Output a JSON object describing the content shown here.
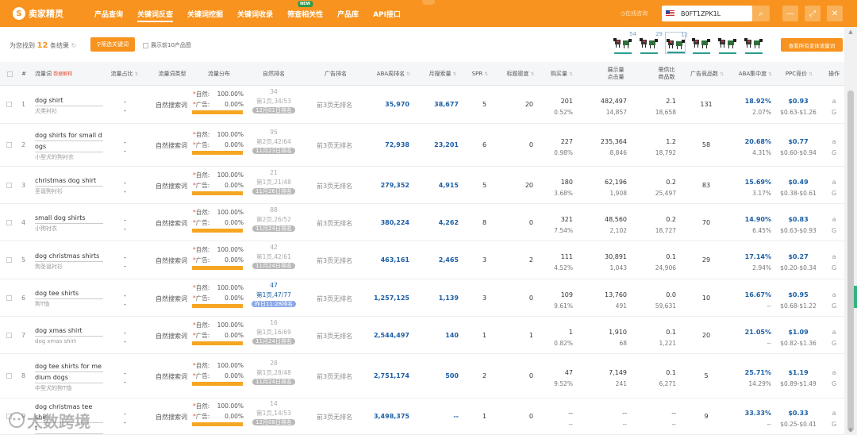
{
  "app": {
    "logo_text": "卖家精灵",
    "nav": [
      {
        "label": "产品查询"
      },
      {
        "label": "关键词反查",
        "active": true
      },
      {
        "label": "关键词挖掘"
      },
      {
        "label": "关键词收录"
      },
      {
        "label": "筛查相关性",
        "badge": "NEW"
      },
      {
        "label": "产品库"
      },
      {
        "label": "API接口"
      }
    ],
    "online_help": "在线咨询",
    "asin_value": "B0FT1ZPK1L",
    "accent_color": "#f7931e"
  },
  "toolbar": {
    "found_prefix": "为您找到",
    "found_count": "12",
    "found_suffix": "条结果",
    "filter_button": "筛选关键词",
    "top10_label": "展示前10产品图",
    "view_all_button": "查看所有变体流量词",
    "thumbs": [
      {
        "count": "54"
      },
      {
        "count": "29"
      },
      {
        "count": "12",
        "selected": true
      },
      {
        "count": ""
      },
      {
        "count": ""
      },
      {
        "count": ""
      }
    ]
  },
  "table": {
    "headers": {
      "idx": "#",
      "keyword": "流量词",
      "keyword_tag": "数据解释",
      "share": "流量占比",
      "type": "流量词类型",
      "dist": "流量分布",
      "natural": "自然排名",
      "ad": "广告排名",
      "aba": "ABA周排名",
      "monthly": "月搜索量",
      "spr": "SPR",
      "title": "标题密度",
      "purchase": "购买量",
      "impr": "展示量\n点击量",
      "supply": "需供比\n商品数",
      "ads_count": "广告竞品数",
      "aba_conc": "ABA集中度",
      "ppc": "PPC竞价",
      "ops": "操作"
    },
    "flow_natural_label": "自然:",
    "flow_ad_label": "广告:",
    "rows": [
      {
        "idx": "1",
        "kw": [
          "dog shirt"
        ],
        "cn": "犬类衬衫",
        "share": "-",
        "share2": "-",
        "type": "自然搜索词",
        "nat_pct": "100.00%",
        "ad_pct": "0.00%",
        "rank_top": "34",
        "rank_mid": "第1页,34/53",
        "rank_date": "12月01日排名",
        "ad_rank": "前3页无排名",
        "aba": "35,970",
        "monthly": "38,677",
        "spr": "5",
        "title": "20",
        "purchase": "201",
        "purchase_pct": "0.52%",
        "impr": "482,497",
        "clicks": "14,857",
        "ratio": "2.1",
        "goods": "18,658",
        "ads": "131",
        "conc": "18.92%",
        "conc2": "2.07%",
        "ppc": "$0.93",
        "ppc_range": "$0.63-$1.26"
      },
      {
        "idx": "2",
        "kw": [
          "dog shirts for small d",
          "ogs"
        ],
        "cn": "小型犬的狗衬衣",
        "share": "-",
        "share2": "-",
        "type": "自然搜索词",
        "nat_pct": "100.00%",
        "ad_pct": "0.00%",
        "rank_top": "95",
        "rank_mid": "第2页,42/64",
        "rank_date": "11月23日排名",
        "ad_rank": "前3页无排名",
        "aba": "72,938",
        "monthly": "23,201",
        "spr": "6",
        "title": "0",
        "purchase": "227",
        "purchase_pct": "0.98%",
        "impr": "235,364",
        "clicks": "8,846",
        "ratio": "1.2",
        "goods": "18,792",
        "ads": "58",
        "conc": "20.68%",
        "conc2": "4.31%",
        "ppc": "$0.77",
        "ppc_range": "$0.60-$0.94"
      },
      {
        "idx": "3",
        "kw": [
          "christmas dog shirt"
        ],
        "cn": "圣诞狗衬衫",
        "share": "-",
        "share2": "-",
        "type": "自然搜索词",
        "nat_pct": "100.00%",
        "ad_pct": "0.00%",
        "rank_top": "21",
        "rank_mid": "第1页,21/48",
        "rank_date": "11月26日排名",
        "ad_rank": "前3页无排名",
        "aba": "279,352",
        "monthly": "4,915",
        "spr": "5",
        "title": "20",
        "purchase": "180",
        "purchase_pct": "3.68%",
        "impr": "62,196",
        "clicks": "1,908",
        "ratio": "0.2",
        "goods": "25,497",
        "ads": "83",
        "conc": "15.69%",
        "conc2": "3.17%",
        "ppc": "$0.49",
        "ppc_range": "$0.38-$0.61"
      },
      {
        "idx": "4",
        "kw": [
          "small dog shirts"
        ],
        "cn": "小狗衬衣",
        "share": "-",
        "share2": "-",
        "type": "自然搜索词",
        "nat_pct": "100.00%",
        "ad_pct": "0.00%",
        "rank_top": "88",
        "rank_mid": "第2页,26/52",
        "rank_date": "11月24日排名",
        "ad_rank": "前3页无排名",
        "aba": "380,224",
        "monthly": "4,262",
        "spr": "8",
        "title": "0",
        "purchase": "321",
        "purchase_pct": "7.54%",
        "impr": "48,560",
        "clicks": "2,102",
        "ratio": "0.2",
        "goods": "18,727",
        "ads": "70",
        "conc": "14.90%",
        "conc2": "6.45%",
        "ppc": "$0.83",
        "ppc_range": "$0.63-$0.93"
      },
      {
        "idx": "5",
        "kw": [
          "dog christmas shirts"
        ],
        "cn": "狗圣诞衬衫",
        "share": "-",
        "share2": "-",
        "type": "自然搜索词",
        "nat_pct": "100.00%",
        "ad_pct": "0.00%",
        "rank_top": "42",
        "rank_mid": "第1页,42/61",
        "rank_date": "11月24日排名",
        "ad_rank": "前3页无排名",
        "aba": "463,161",
        "monthly": "2,465",
        "spr": "3",
        "title": "2",
        "purchase": "111",
        "purchase_pct": "4.52%",
        "impr": "30,891",
        "clicks": "1,043",
        "ratio": "0.1",
        "goods": "24,906",
        "ads": "29",
        "conc": "17.14%",
        "conc2": "2.94%",
        "ppc": "$0.27",
        "ppc_range": "$0.20-$0.34"
      },
      {
        "idx": "6",
        "kw": [
          "dog tee shirts"
        ],
        "cn": "狗T恤",
        "share": "-",
        "share2": "-",
        "type": "自然搜索词",
        "nat_pct": "100.00%",
        "ad_pct": "0.00%",
        "rank_top": "47",
        "rank_mid": "第1页,47/77",
        "rank_date": "昨日11:28排名",
        "rank_hl": true,
        "ad_rank": "前3页无排名",
        "aba": "1,257,125",
        "monthly": "1,139",
        "spr": "3",
        "title": "0",
        "purchase": "109",
        "purchase_pct": "9.61%",
        "impr": "13,760",
        "clicks": "491",
        "ratio": "0.0",
        "goods": "59,631",
        "ads": "10",
        "conc": "16.67%",
        "conc2": "--",
        "ppc": "$0.95",
        "ppc_range": "$0.68-$1.22"
      },
      {
        "idx": "7",
        "kw": [
          "dog xmas shirt"
        ],
        "cn": "dog xmas shirt",
        "share": "-",
        "share2": "-",
        "type": "自然搜索词",
        "nat_pct": "100.00%",
        "ad_pct": "0.00%",
        "rank_top": "16",
        "rank_mid": "第1页,16/69",
        "rank_date": "11月24日排名",
        "ad_rank": "前3页无排名",
        "aba": "2,544,497",
        "monthly": "140",
        "spr": "1",
        "title": "1",
        "purchase": "1",
        "purchase_pct": "0.82%",
        "impr": "1,910",
        "clicks": "68",
        "ratio": "0.1",
        "goods": "1,221",
        "ads": "20",
        "conc": "21.05%",
        "conc2": "--",
        "ppc": "$1.09",
        "ppc_range": "$0.82-$1.36"
      },
      {
        "idx": "8",
        "kw": [
          "dog tee shirts for me",
          "dium dogs"
        ],
        "cn": "中型犬的狗T恤",
        "share": "-",
        "share2": "-",
        "type": "自然搜索词",
        "nat_pct": "100.00%",
        "ad_pct": "0.00%",
        "rank_top": "28",
        "rank_mid": "第1页,28/48",
        "rank_date": "11月24日排名",
        "ad_rank": "前3页无排名",
        "aba": "2,751,174",
        "monthly": "500",
        "spr": "2",
        "title": "0",
        "purchase": "47",
        "purchase_pct": "9.52%",
        "impr": "7,149",
        "clicks": "241",
        "ratio": "0.1",
        "goods": "6,271",
        "ads": "5",
        "conc": "25.71%",
        "conc2": "14.29%",
        "ppc": "$1.19",
        "ppc_range": "$0.89-$1.49"
      },
      {
        "idx": "9",
        "kw": [
          "dog christmas tee shir",
          "t"
        ],
        "cn": "狗圣诞T恤",
        "share": "-",
        "share2": "-",
        "type": "自然搜索词",
        "nat_pct": "100.00%",
        "ad_pct": "0.00%",
        "rank_top": "14",
        "rank_mid": "第1页,14/53",
        "rank_date": "12月08日排名",
        "ad_rank": "前3页无排名",
        "aba": "3,498,375",
        "monthly": "--",
        "spr": "1",
        "title": "0",
        "purchase": "--",
        "purchase_pct": "--",
        "impr": "--",
        "clicks": "--",
        "ratio": "--",
        "goods": "--",
        "ads": "9",
        "conc": "33.33%",
        "conc2": "--",
        "ppc": "$0.33",
        "ppc_range": "$0.25-$0.41"
      }
    ]
  },
  "watermark": "大数跨境"
}
